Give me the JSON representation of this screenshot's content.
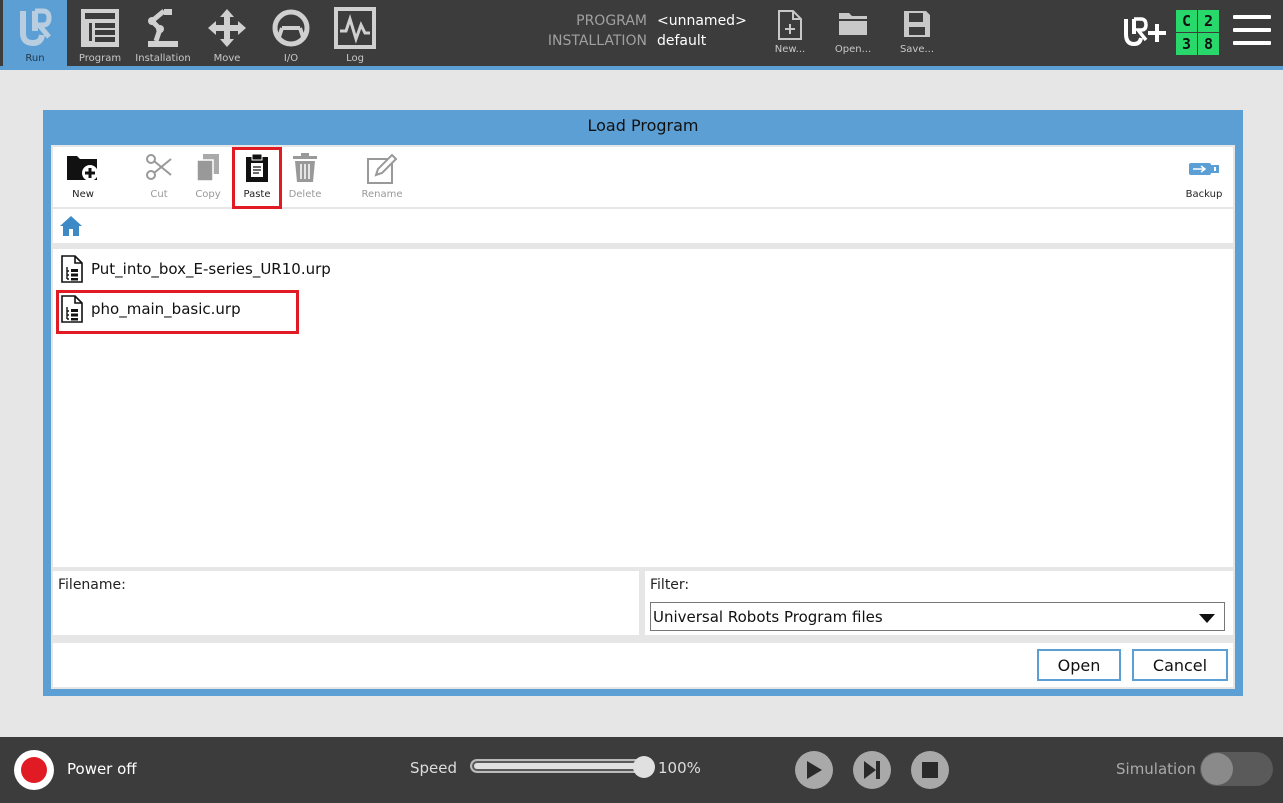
{
  "topbar": {
    "nav": [
      {
        "label": "Run",
        "icon": "ur-logo-icon",
        "active": true
      },
      {
        "label": "Program",
        "icon": "program-icon"
      },
      {
        "label": "Installation",
        "icon": "robot-arm-icon"
      },
      {
        "label": "Move",
        "icon": "move-arrows-icon"
      },
      {
        "label": "I/O",
        "icon": "io-icon"
      },
      {
        "label": "Log",
        "icon": "log-icon"
      }
    ],
    "program_label": "PROGRAM",
    "program_value": "<unnamed>",
    "installation_label": "INSTALLATION",
    "installation_value": "default",
    "file_buttons": [
      {
        "label": "New...",
        "icon": "new-file-icon"
      },
      {
        "label": "Open...",
        "icon": "folder-icon"
      },
      {
        "label": "Save...",
        "icon": "save-icon"
      }
    ],
    "counter": [
      "C",
      "2",
      "3",
      "8"
    ],
    "colors": {
      "bar": "#3c3c3c",
      "accent": "#5b9fd4",
      "counter": "#28d86a"
    }
  },
  "dialog": {
    "title": "Load Program",
    "toolbar": {
      "new": "New",
      "cut": "Cut",
      "copy": "Copy",
      "paste": "Paste",
      "delete": "Delete",
      "rename": "Rename",
      "backup": "Backup"
    },
    "path_icon": "home-icon",
    "files": [
      {
        "name": "Put_into_box_E-series_UR10.urp"
      },
      {
        "name": "pho_main_basic.urp"
      }
    ],
    "filename_label": "Filename:",
    "filename_value": "",
    "filter_label": "Filter:",
    "filter_value": "Universal Robots Program files",
    "open_label": "Open",
    "cancel_label": "Cancel",
    "highlight_color": "#e01b24"
  },
  "bottombar": {
    "power_label": "Power off",
    "speed_label": "Speed",
    "speed_value": "100%",
    "speed_fraction": 1.0,
    "simulation_label": "Simulation",
    "simulation_on": false
  }
}
